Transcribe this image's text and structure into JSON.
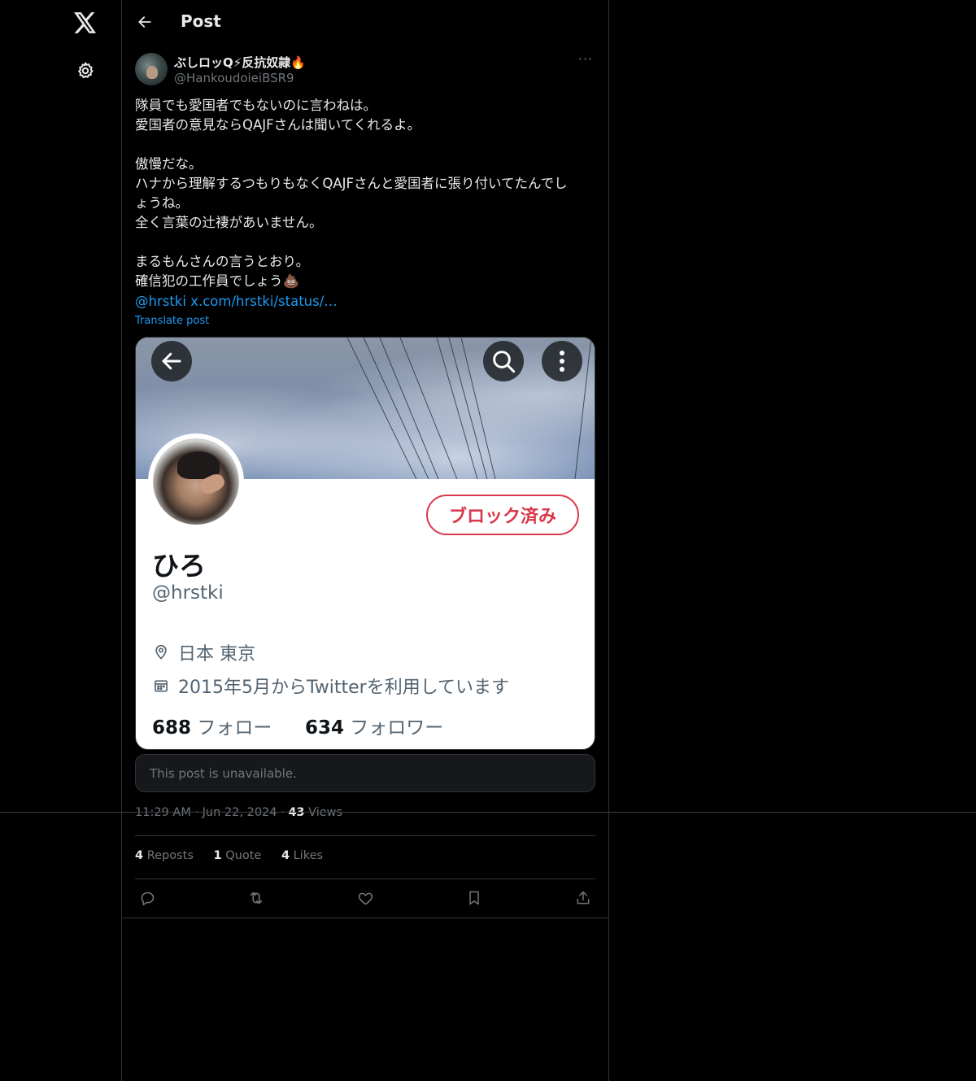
{
  "nav": {
    "logo_icon": "x-logo-icon",
    "settings_icon": "gear-icon"
  },
  "header": {
    "title": "Post",
    "back_icon": "arrow-left-icon"
  },
  "post": {
    "author": {
      "display_name": "ぶしロッQ⚡反抗奴隷🔥",
      "handle": "@HankoudoieiBSR9"
    },
    "text": "隊員でも愛国者でもないのに言わねは。\n愛国者の意見ならQAJFさんは聞いてくれるよ。\n\n傲慢だな。\nハナから理解するつもりもなくQAJFさんと愛国者に張り付いてたんでし\nょうね。\n全く言葉の辻褄があいません。\n\nまるもんさんの言うとおり。\n確信犯の工作員でしょう💩",
    "mention": "@hrstki",
    "link": "x.com/hrstki/status/…",
    "translate_label": "Translate post",
    "unavailable_text": "This post is unavailable.",
    "time": "11:29 AM",
    "date": "Jun 22, 2024",
    "views_count": "43",
    "views_label": "Views",
    "reposts_count": "4",
    "reposts_label": "Reposts",
    "quotes_count": "1",
    "quotes_label": "Quote",
    "likes_count": "4",
    "likes_label": "Likes"
  },
  "screenshot_card": {
    "blocked_label": "ブロック済み",
    "name": "ひろ",
    "handle": "@hrstki",
    "location": "日本 東京",
    "joined": "2015年5月からTwitterを利用しています",
    "following_count": "688",
    "following_label": "フォロー",
    "followers_count": "634",
    "followers_label": "フォロワー"
  },
  "colors": {
    "background": "#000000",
    "text_primary": "#e7e9ea",
    "text_secondary": "#71767b",
    "link": "#1d9bf0",
    "border": "#2f3336",
    "blocked_red": "#d9374b"
  }
}
